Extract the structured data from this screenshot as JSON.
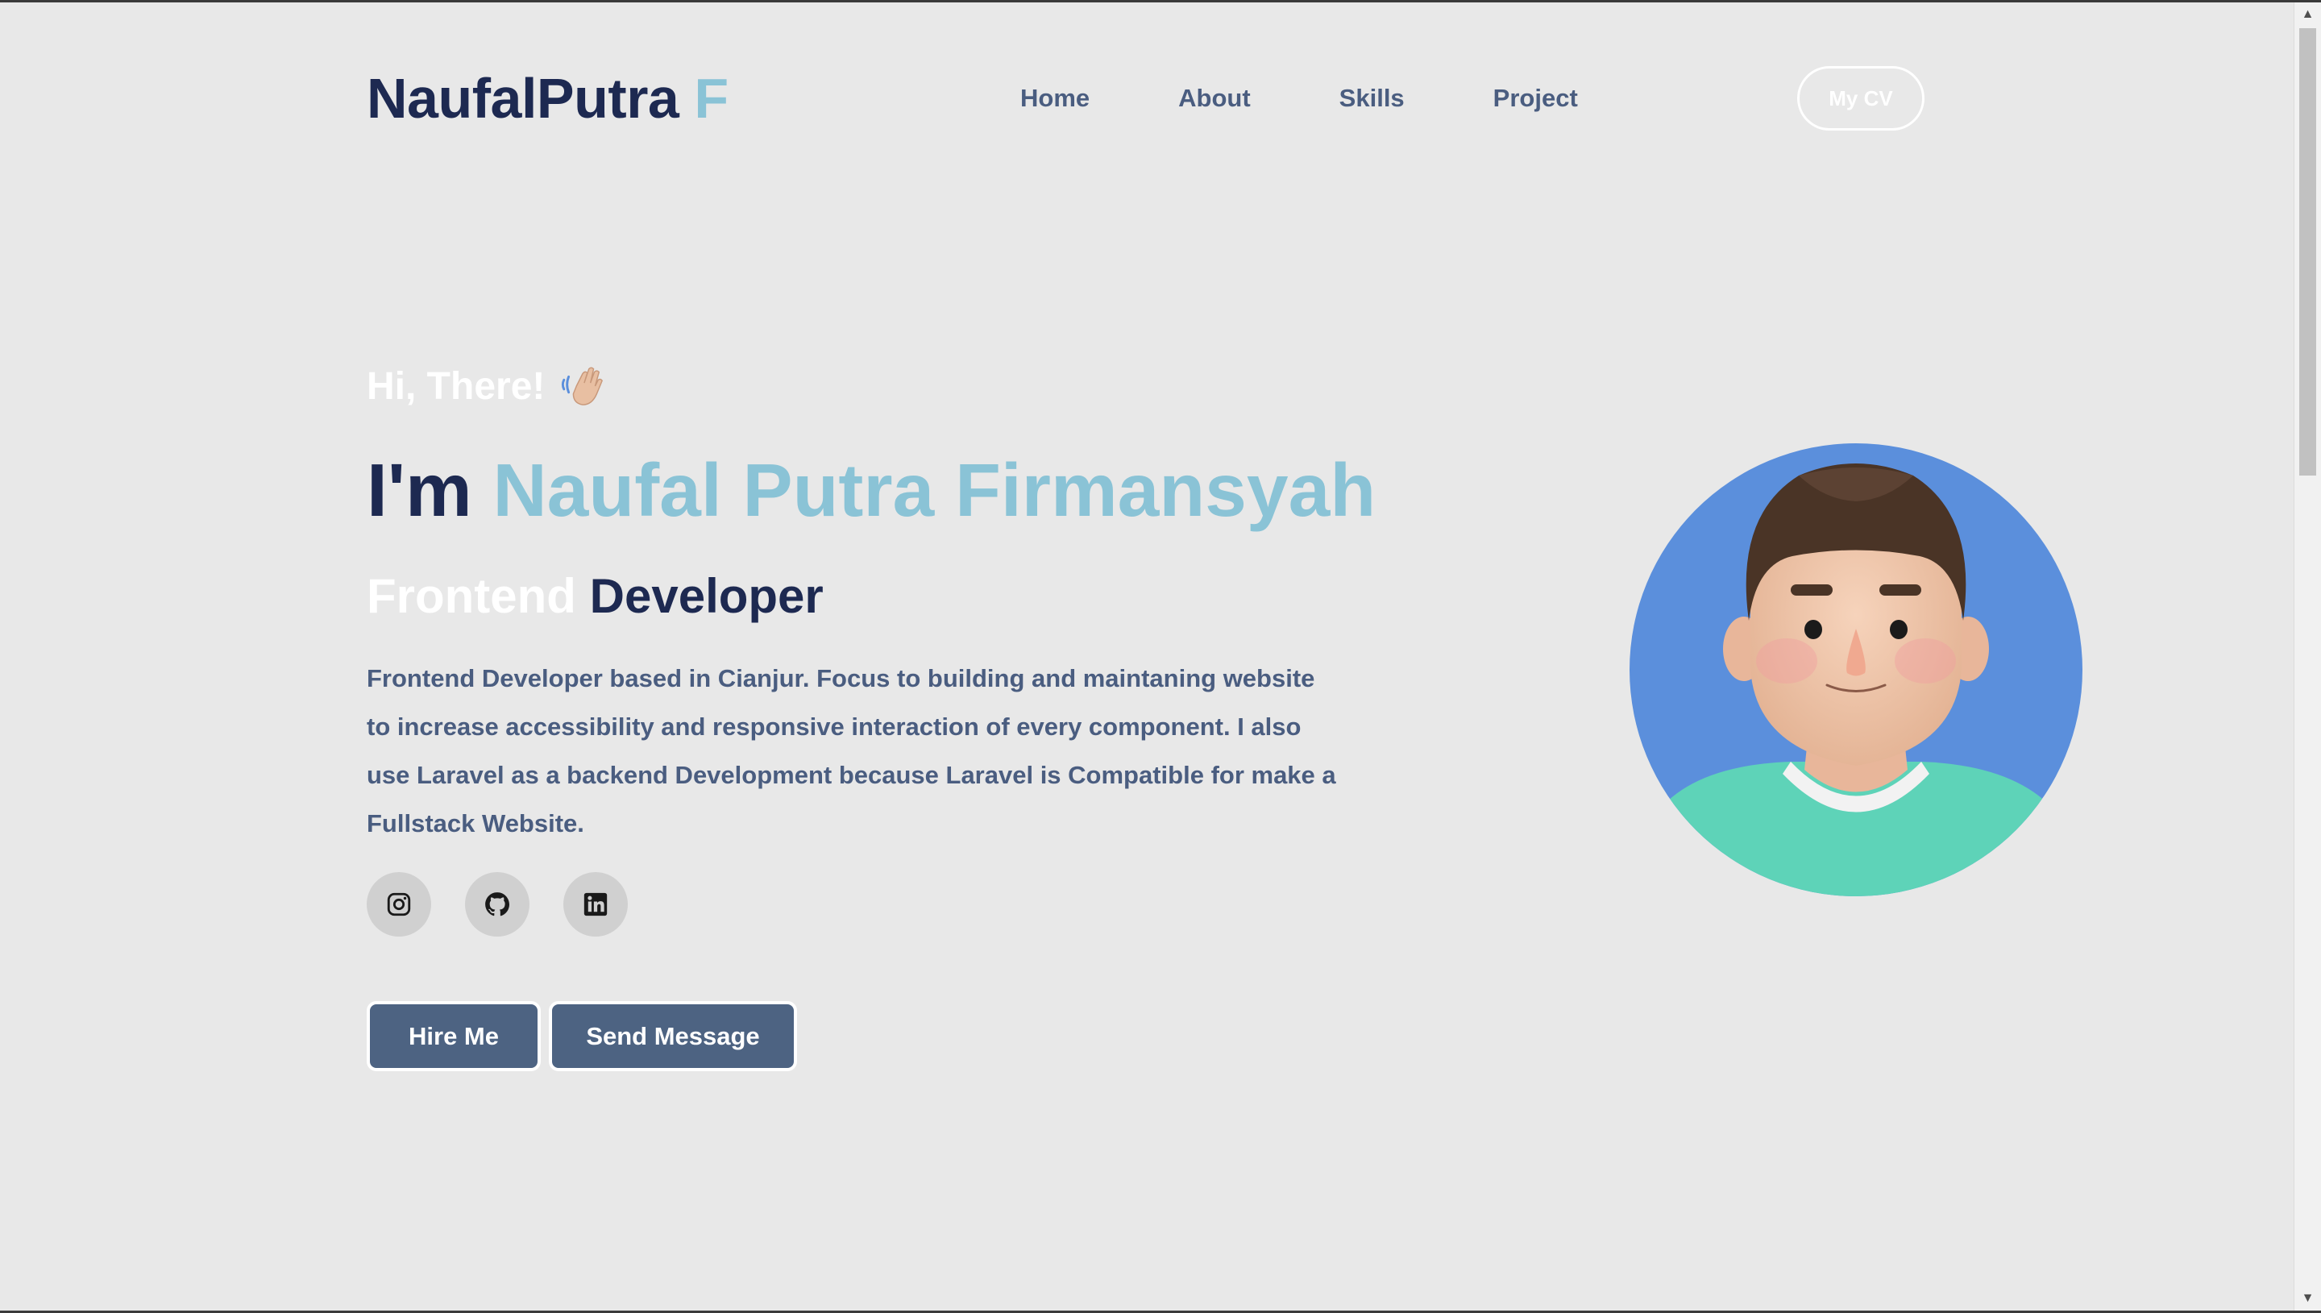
{
  "nav": {
    "logo_main": "NaufalPutra",
    "logo_accent": "F",
    "links": [
      "Home",
      "About",
      "Skills",
      "Project"
    ],
    "cv_label": "My CV"
  },
  "hero": {
    "greeting": "Hi, There!",
    "headline_prefix": "I'm",
    "name": "Naufal Putra Firmansyah",
    "role_part1": "Frontend",
    "role_part2": "Developer",
    "description": "Frontend Developer based in Cianjur. Focus to building and maintaning website to increase accessibility and responsive interaction of every component. I also use Laravel as a backend Development because Laravel is Compatible for make a Fullstack Website.",
    "hire_label": "Hire Me",
    "send_label": "Send Message"
  },
  "socials": [
    {
      "icon": "instagram-icon"
    },
    {
      "icon": "github-icon"
    },
    {
      "icon": "linkedin-icon"
    }
  ],
  "colors": {
    "background": "#e8e8e8",
    "primary": "#1d2951",
    "accent": "#8ac3d6",
    "muted": "#4a5d80",
    "button": "#4d6382",
    "avatar_bg": "#5b8fdc",
    "shirt": "#5ed3b8"
  }
}
